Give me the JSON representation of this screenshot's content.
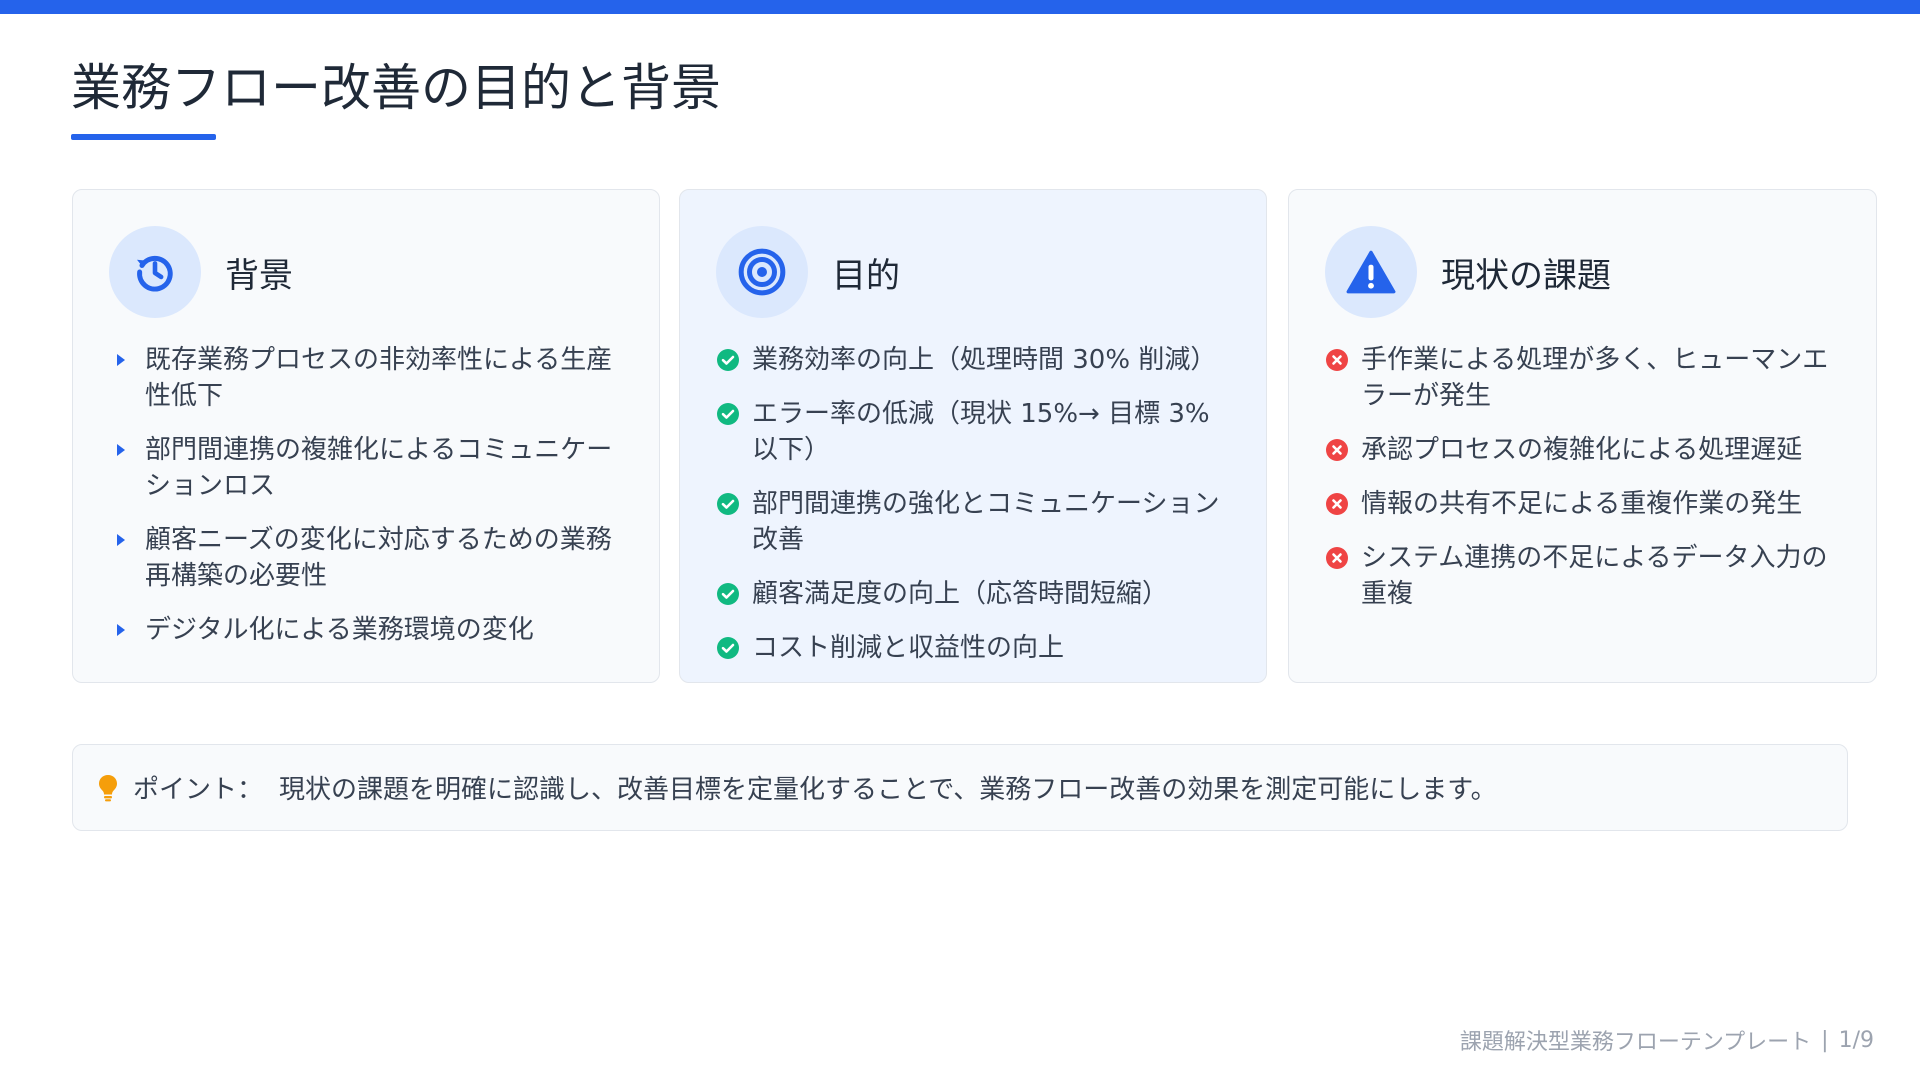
{
  "title": "業務フロー改善の目的と背景",
  "cards": [
    {
      "title": "背景",
      "icon": "history-icon",
      "items": [
        "既存業務プロセスの非効率性による生産性低下",
        "部門間連携の複雑化によるコミュニケーションロス",
        "顧客ニーズの変化に対応するための業務再構築の必要性",
        "デジタル化による業務環境の変化"
      ]
    },
    {
      "title": "目的",
      "icon": "target-icon",
      "items": [
        "業務効率の向上（処理時間 30% 削減）",
        "エラー率の低減（現状 15%→ 目標 3% 以下）",
        "部門間連携の強化とコミュニケーション改善",
        "顧客満足度の向上（応答時間短縮）",
        "コスト削減と収益性の向上"
      ]
    },
    {
      "title": "現状の課題",
      "icon": "warning-icon",
      "items": [
        "手作業による処理が多く、ヒューマンエラーが発生",
        "承認プロセスの複雑化による処理遅延",
        "情報の共有不足による重複作業の発生",
        "システム連携の不足によるデータ入力の重複"
      ]
    }
  ],
  "point": {
    "icon": "lightbulb-icon",
    "label": "ポイント：",
    "text": "現状の課題を明確に認識し、改善目標を定量化することで、業務フロー改善の効果を測定可能にします。"
  },
  "footer": {
    "template_name": "課題解決型業務フローテンプレート",
    "separator": "|",
    "page": "1/9"
  },
  "colors": {
    "accent": "#2563eb",
    "check": "#10b981",
    "cross": "#ef4444",
    "bulb": "#f59e0b",
    "icon_bg": "#dbe8fd"
  }
}
